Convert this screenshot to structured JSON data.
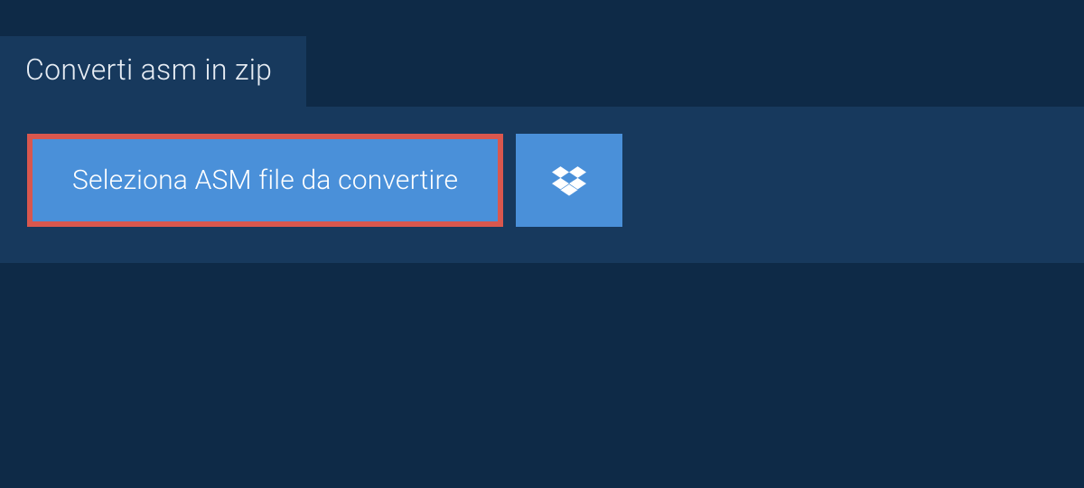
{
  "tab": {
    "label": "Converti asm in zip"
  },
  "actions": {
    "select_file_label": "Seleziona ASM file da convertire"
  },
  "colors": {
    "background": "#0e2a47",
    "panel": "#17395d",
    "button": "#4a90d9",
    "highlight_border": "#d9574e",
    "text_light": "#ffffff"
  }
}
